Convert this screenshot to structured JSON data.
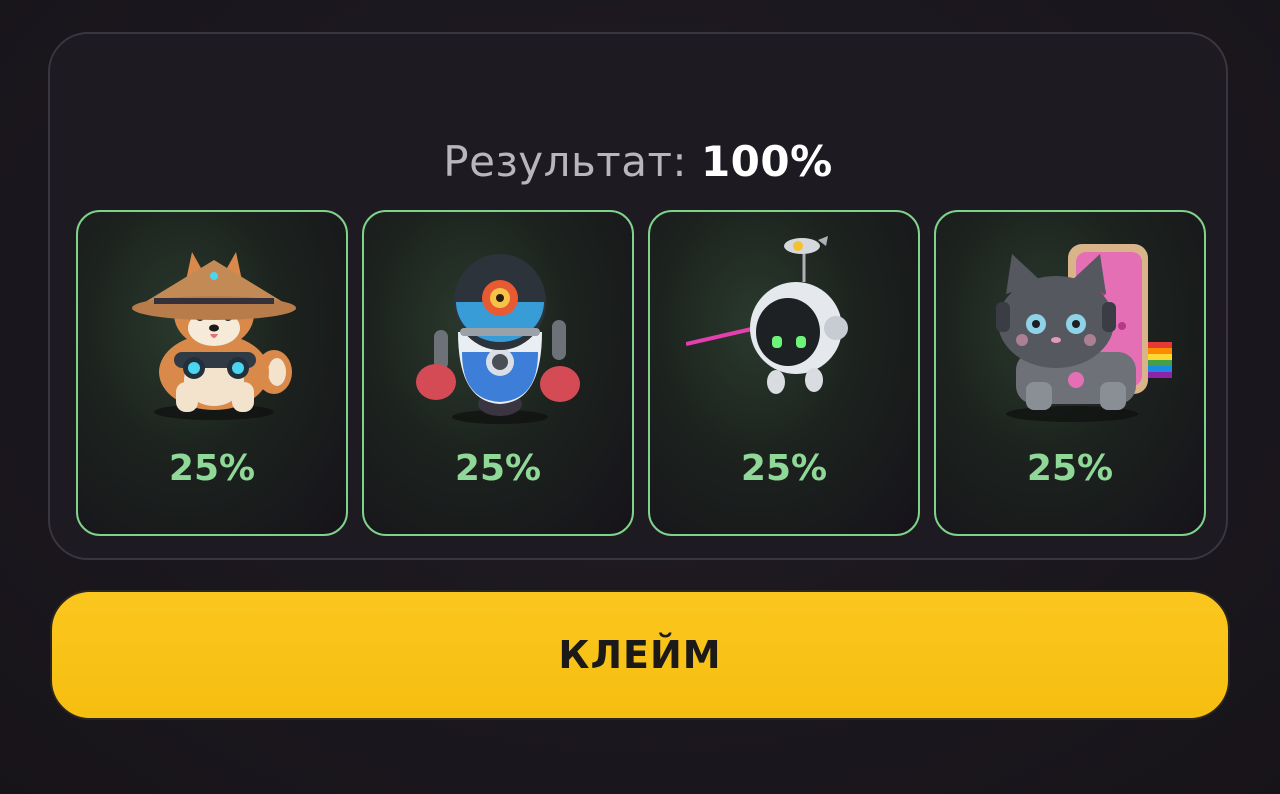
{
  "result": {
    "label": "Результат:",
    "value": "100%"
  },
  "cards": [
    {
      "name": "shiba-samurai",
      "icon": "shiba-dog-icon",
      "percent": "25%"
    },
    {
      "name": "boxing-robot",
      "icon": "boxing-robot-icon",
      "percent": "25%"
    },
    {
      "name": "drone-robot",
      "icon": "drone-robot-icon",
      "percent": "25%"
    },
    {
      "name": "robot-cat",
      "icon": "robot-cat-icon",
      "percent": "25%"
    }
  ],
  "claim_button": {
    "label": "КЛЕЙМ"
  },
  "colors": {
    "accent_green": "#8fd897",
    "button_yellow": "#f8c318"
  }
}
